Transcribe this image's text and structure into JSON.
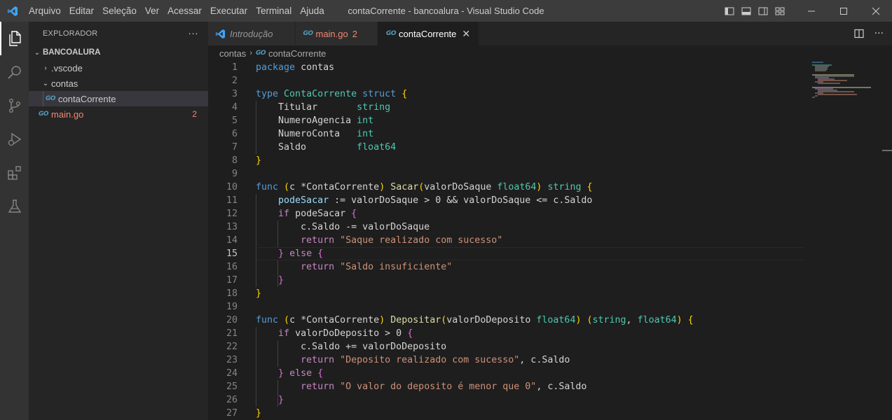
{
  "titlebar": {
    "menu": [
      "Arquivo",
      "Editar",
      "Seleção",
      "Ver",
      "Acessar",
      "Executar",
      "Terminal",
      "Ajuda"
    ],
    "title": "contaCorrente - bancoalura - Visual Studio Code"
  },
  "sidebar": {
    "header": "EXPLORADOR",
    "more": "···",
    "root": "BANCOALURA",
    "items": [
      {
        "label": ".vscode"
      },
      {
        "label": "contas"
      },
      {
        "label": "contaCorrente"
      },
      {
        "label": "main.go",
        "badge": "2"
      }
    ]
  },
  "tabs": [
    {
      "label": "Introdução"
    },
    {
      "label": "main.go",
      "badge": "2"
    },
    {
      "label": "contaCorrente",
      "close": "✕"
    }
  ],
  "breadcrumb": {
    "folder": "contas",
    "file": "contaCorrente"
  },
  "editor": {
    "current_line": 15,
    "line_numbers": [
      "1",
      "2",
      "3",
      "4",
      "5",
      "6",
      "7",
      "8",
      "9",
      "10",
      "11",
      "12",
      "13",
      "14",
      "15",
      "16",
      "17",
      "18",
      "19",
      "20",
      "21",
      "22",
      "23",
      "24",
      "25",
      "26",
      "27"
    ],
    "code": {
      "l1_kw": "package",
      "l1_name": "contas",
      "l3_kw": "type",
      "l3_type": "ContaCorrente",
      "l3_struct": "struct",
      "l4_field": "Titular",
      "l4_type": "string",
      "l5_field": "NumeroAgencia",
      "l5_type": "int",
      "l6_field": "NumeroConta",
      "l6_type": "int",
      "l7_field": "Saldo",
      "l7_type": "float64",
      "l10_kw": "func",
      "l10_recv": "c",
      "l10_rtype": "ContaCorrente",
      "l10_fn": "Sacar",
      "l10_param": "valorDoSaque",
      "l10_ptype": "float64",
      "l10_ret": "string",
      "l11_var": "podeSacar",
      "l11_rest": ":= valorDoSaque > 0 && valorDoSaque <= c.Saldo",
      "l12_kw": "if",
      "l12_cond": "podeSacar",
      "l13": "c.Saldo -= valorDoSaque",
      "l14_kw": "return",
      "l14_str": "\"Saque realizado com sucesso\"",
      "l15_kw": "else",
      "l16_kw": "return",
      "l16_str": "\"Saldo insuficiente\"",
      "l20_kw": "func",
      "l20_recv": "c",
      "l20_rtype": "ContaCorrente",
      "l20_fn": "Depositar",
      "l20_param": "valorDoDeposito",
      "l20_ptype": "float64",
      "l20_ret1": "string",
      "l20_ret2": "float64",
      "l21_kw": "if",
      "l21_cond": "valorDoDeposito > ",
      "l21_num": "0",
      "l22": "c.Saldo += valorDoDeposito",
      "l23_kw": "return",
      "l23_str": "\"Deposito realizado com sucesso\"",
      "l23_rest": ", c.Saldo",
      "l24_kw": "else",
      "l25_kw": "return",
      "l25_str": "\"O valor do deposito é menor que 0\"",
      "l25_rest": ", c.Saldo"
    }
  },
  "colors": {
    "accent": "#007acc",
    "keyword": "#569cd6",
    "control": "#c586c0",
    "type": "#4ec9b0",
    "function": "#dcdcaa",
    "string": "#ce9178",
    "error_badge": "#f48771"
  }
}
